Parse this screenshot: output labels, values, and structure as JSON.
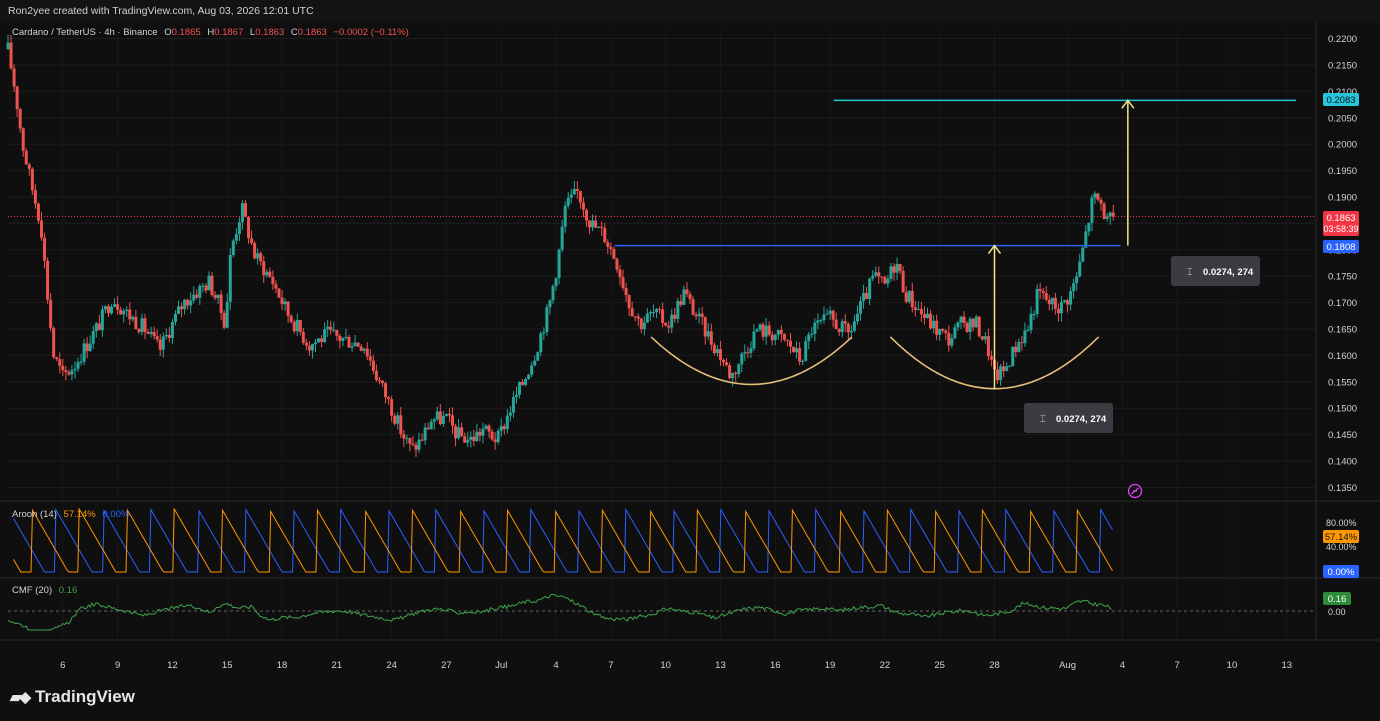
{
  "header": {
    "credit": "Ron2yee created with TradingView.com, Aug 03, 2026 12:01 UTC"
  },
  "legend": {
    "symbol": "Cardano / TetherUS · 4h · Binance",
    "o_label": "O",
    "o": "0.1865",
    "h_label": "H",
    "h": "0.1867",
    "l_label": "L",
    "l": "0.1863",
    "c_label": "C",
    "c": "0.1863",
    "change": "−0.0002 (−0.11%)"
  },
  "colors": {
    "up": "#26a69a",
    "down": "#ef5350",
    "resistance": "#2962ff",
    "target": "#26c6da",
    "arrow": "#f6e58d",
    "curve": "#e6c07b",
    "aroon_up": "#ff9800",
    "aroon_down": "#2962ff",
    "cmf": "#3fa34d"
  },
  "badges": {
    "target": "0.2083",
    "last_price": "0.1863",
    "countdown": "03:58:39",
    "resistance": "0.1808"
  },
  "measure_labels": [
    "0.0274, 274",
    "0.0274, 274"
  ],
  "aroon": {
    "title": "Aroon (14)",
    "up_value": "57.14%",
    "down_value": "0.00%",
    "axis_ticks": [
      "80.00%",
      "40.00%"
    ]
  },
  "cmf": {
    "title": "CMF (20)",
    "value": "0.16",
    "axis_tick": "0.00"
  },
  "brand": {
    "name": "TradingView"
  },
  "chart_data": {
    "type": "candlestick",
    "title": "Cardano / TetherUS · 4h · Binance",
    "ylim": [
      0.133,
      0.222
    ],
    "y_ticks": [
      "0.2200",
      "0.2150",
      "0.2100",
      "0.2050",
      "0.2000",
      "0.1950",
      "0.1900",
      "0.1850",
      "0.1800",
      "0.1750",
      "0.1700",
      "0.1650",
      "0.1600",
      "0.1550",
      "0.1500",
      "0.1450",
      "0.1400",
      "0.1350"
    ],
    "x_ticks": [
      {
        "label": "6",
        "day": 6
      },
      {
        "label": "9",
        "day": 9
      },
      {
        "label": "12",
        "day": 12
      },
      {
        "label": "15",
        "day": 15
      },
      {
        "label": "18",
        "day": 18
      },
      {
        "label": "21",
        "day": 21
      },
      {
        "label": "24",
        "day": 24
      },
      {
        "label": "27",
        "day": 27
      },
      {
        "label": "Jul",
        "day": 30
      },
      {
        "label": "4",
        "day": 33
      },
      {
        "label": "7",
        "day": 36
      },
      {
        "label": "10",
        "day": 39
      },
      {
        "label": "13",
        "day": 42
      },
      {
        "label": "16",
        "day": 45
      },
      {
        "label": "19",
        "day": 48
      },
      {
        "label": "22",
        "day": 51
      },
      {
        "label": "25",
        "day": 54
      },
      {
        "label": "28",
        "day": 57
      },
      {
        "label": "Aug",
        "day": 61
      },
      {
        "label": "4",
        "day": 64
      },
      {
        "label": "7",
        "day": 67
      },
      {
        "label": "10",
        "day": 70
      },
      {
        "label": "13",
        "day": 73
      }
    ],
    "price_path": [
      [
        3.0,
        0.218
      ],
      [
        3.4,
        0.21
      ],
      [
        3.8,
        0.2
      ],
      [
        4.3,
        0.192
      ],
      [
        4.8,
        0.185
      ],
      [
        5.2,
        0.17
      ],
      [
        5.5,
        0.16
      ],
      [
        6.0,
        0.156
      ],
      [
        6.6,
        0.158
      ],
      [
        7.3,
        0.162
      ],
      [
        8.0,
        0.166
      ],
      [
        8.7,
        0.171
      ],
      [
        9.5,
        0.168
      ],
      [
        10.5,
        0.165
      ],
      [
        11.3,
        0.161
      ],
      [
        12.0,
        0.166
      ],
      [
        12.6,
        0.17
      ],
      [
        13.3,
        0.172
      ],
      [
        14.0,
        0.174
      ],
      [
        14.5,
        0.17
      ],
      [
        14.9,
        0.166
      ],
      [
        15.2,
        0.18
      ],
      [
        15.8,
        0.188
      ],
      [
        16.5,
        0.179
      ],
      [
        17.5,
        0.174
      ],
      [
        18.3,
        0.168
      ],
      [
        19.5,
        0.162
      ],
      [
        20.5,
        0.164
      ],
      [
        21.5,
        0.163
      ],
      [
        22.5,
        0.162
      ],
      [
        23.2,
        0.156
      ],
      [
        24.0,
        0.15
      ],
      [
        24.6,
        0.145
      ],
      [
        25.1,
        0.142
      ],
      [
        25.6,
        0.144
      ],
      [
        26.2,
        0.148
      ],
      [
        27.0,
        0.148
      ],
      [
        27.6,
        0.145
      ],
      [
        28.3,
        0.144
      ],
      [
        29.0,
        0.146
      ],
      [
        29.8,
        0.144
      ],
      [
        30.5,
        0.15
      ],
      [
        31.2,
        0.155
      ],
      [
        31.9,
        0.161
      ],
      [
        32.6,
        0.169
      ],
      [
        33.1,
        0.178
      ],
      [
        33.5,
        0.188
      ],
      [
        34.2,
        0.191
      ],
      [
        34.9,
        0.185
      ],
      [
        35.6,
        0.183
      ],
      [
        36.3,
        0.178
      ],
      [
        37.0,
        0.17
      ],
      [
        37.6,
        0.166
      ],
      [
        38.3,
        0.168
      ],
      [
        39.2,
        0.166
      ],
      [
        40.0,
        0.172
      ],
      [
        40.6,
        0.168
      ],
      [
        41.3,
        0.164
      ],
      [
        42.0,
        0.16
      ],
      [
        42.6,
        0.156
      ],
      [
        43.2,
        0.16
      ],
      [
        44.0,
        0.165
      ],
      [
        45.0,
        0.164
      ],
      [
        45.8,
        0.162
      ],
      [
        46.4,
        0.159
      ],
      [
        47.0,
        0.165
      ],
      [
        48.0,
        0.167
      ],
      [
        49.0,
        0.164
      ],
      [
        49.8,
        0.17
      ],
      [
        50.4,
        0.175
      ],
      [
        51.0,
        0.173
      ],
      [
        51.6,
        0.178
      ],
      [
        52.1,
        0.172
      ],
      [
        53.0,
        0.168
      ],
      [
        53.8,
        0.165
      ],
      [
        54.5,
        0.163
      ],
      [
        55.2,
        0.166
      ],
      [
        56.0,
        0.166
      ],
      [
        56.6,
        0.162
      ],
      [
        57.0,
        0.156
      ],
      [
        57.5,
        0.157
      ],
      [
        58.2,
        0.162
      ],
      [
        58.8,
        0.165
      ],
      [
        59.4,
        0.172
      ],
      [
        60.0,
        0.17
      ],
      [
        60.6,
        0.169
      ],
      [
        61.2,
        0.172
      ],
      [
        61.6,
        0.176
      ],
      [
        62.0,
        0.183
      ],
      [
        62.4,
        0.19
      ],
      [
        62.8,
        0.189
      ],
      [
        63.2,
        0.185
      ],
      [
        63.5,
        0.1863
      ]
    ],
    "resistance": {
      "value": 0.1808,
      "from_day": 36.2,
      "to_day": 63.9
    },
    "target": {
      "value": 0.2083,
      "from_day": 48.2,
      "to_day": 73.5
    },
    "measured_move": 0.0274,
    "annotations": [
      {
        "type": "arc",
        "center_day": 43.7,
        "low": 0.1545,
        "top": 0.1635,
        "half_width_days": 5.5
      },
      {
        "type": "arc",
        "center_day": 57.0,
        "low": 0.1537,
        "top": 0.1635,
        "half_width_days": 5.7
      },
      {
        "type": "arrow",
        "day": 57.0,
        "from": 0.1537,
        "to": 0.1808
      },
      {
        "type": "arrow",
        "day": 64.3,
        "from": 0.1808,
        "to": 0.2083
      }
    ]
  }
}
